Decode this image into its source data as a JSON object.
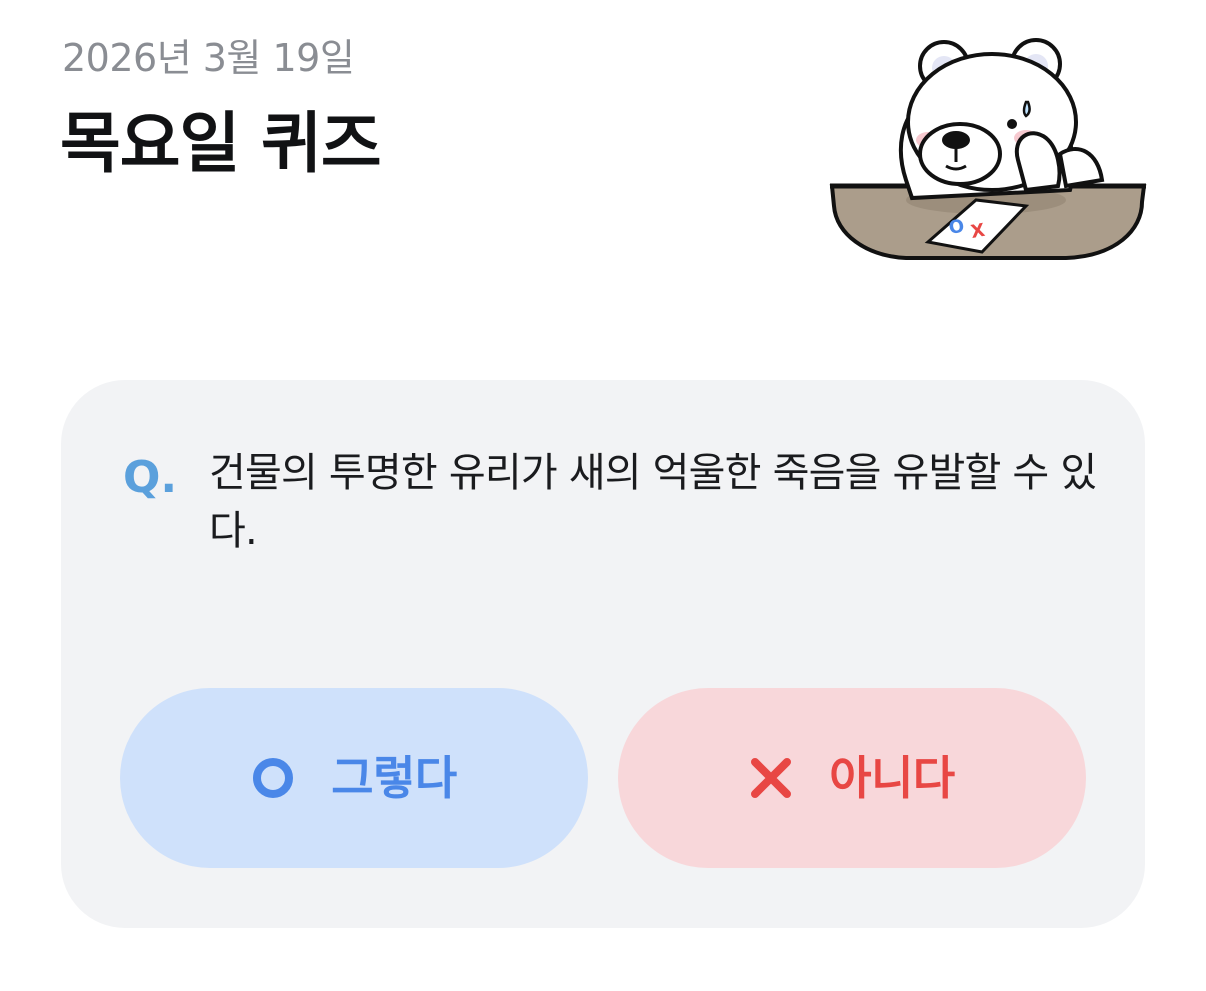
{
  "header": {
    "date": "2026년 3월 19일",
    "title": "목요일 퀴즈"
  },
  "quiz": {
    "question_marker": "Q.",
    "question": "건물의 투명한 유리가 새의 억울한 죽음을 유발할 수 있다.",
    "answers": [
      {
        "label": "그렇다",
        "icon": "circle-o-icon",
        "color": "#4a87e8",
        "background": "#cfe1fb"
      },
      {
        "label": "아니다",
        "icon": "x-mark-icon",
        "color": "#e84744",
        "background": "#f8d7da"
      }
    ]
  },
  "mascot": {
    "icon": "polar-bear-thinking-illustration",
    "card_text": "OX"
  },
  "colors": {
    "accent_blue": "#5ba0dc",
    "card_background": "#f2f3f5"
  }
}
